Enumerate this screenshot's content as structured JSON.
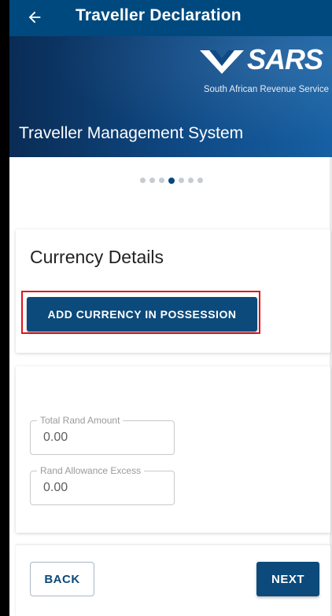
{
  "header": {
    "back_icon": "arrow-left-icon",
    "title": "Traveller Declaration",
    "background": "#00497e"
  },
  "banner": {
    "logo_text": "SARS",
    "logo_subtitle": "South African Revenue Service",
    "system_title": "Traveller Management System"
  },
  "stepper": {
    "total_steps": 7,
    "active_step": 4,
    "active_color": "#00497e",
    "inactive_color": "#c6cbd1"
  },
  "currency": {
    "title": "Currency Details",
    "add_button_label": "ADD CURRENCY IN POSSESSION",
    "highlight_color": "#e3141b"
  },
  "amounts": {
    "total_rand_amount": {
      "label": "Total Rand Amount",
      "value": "0.00"
    },
    "rand_allowance_excess": {
      "label": "Rand Allowance Excess",
      "value": "0.00"
    }
  },
  "navigation": {
    "back_label": "BACK",
    "next_label": "NEXT"
  },
  "colors": {
    "primary": "#0b4a7a",
    "banner_dark": "#0a2c55",
    "banner_light": "#1660a3"
  }
}
